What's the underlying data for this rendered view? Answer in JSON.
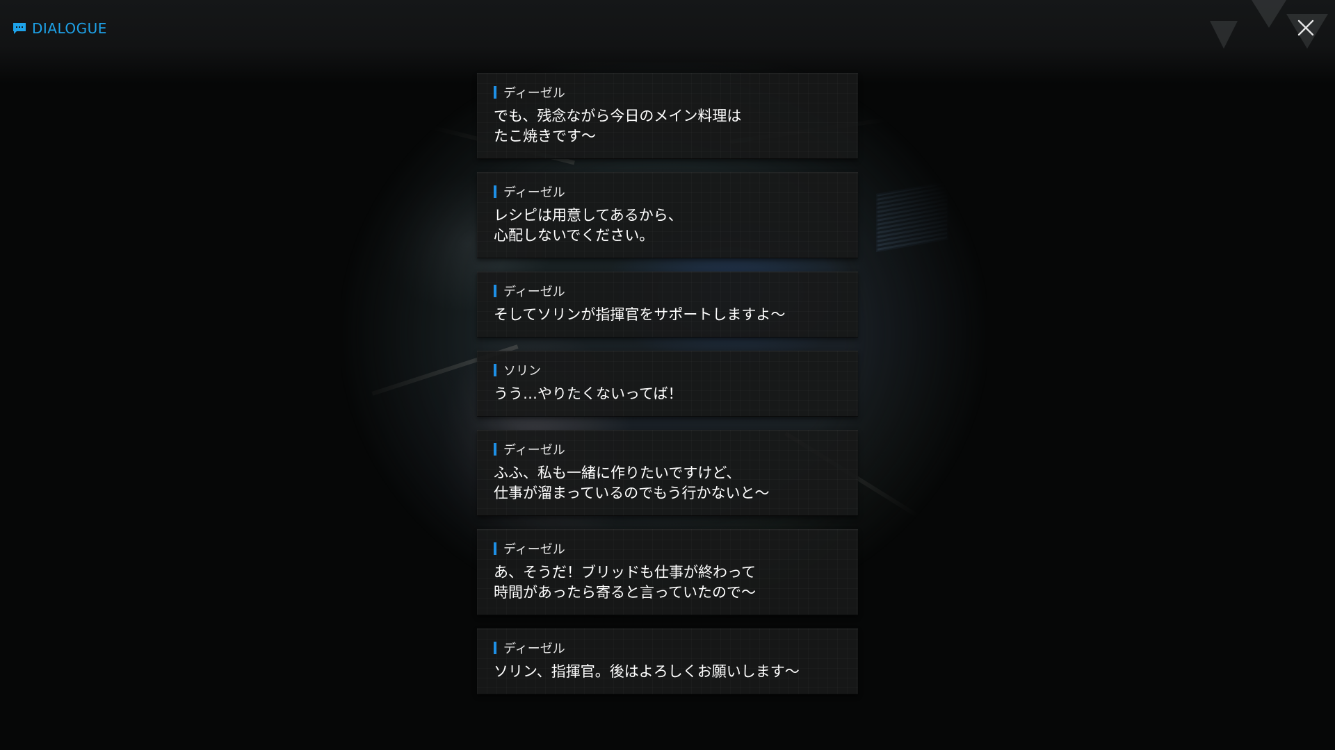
{
  "header": {
    "title": "DIALOGUE",
    "title_icon": "chat-bubble-icon",
    "close_icon": "close-icon",
    "accent_color": "#1ea3ea"
  },
  "dialogue": [
    {
      "speaker": "ディーゼル",
      "text": "でも、残念ながら今日のメイン料理は\nたこ焼きです～"
    },
    {
      "speaker": "ディーゼル",
      "text": "レシピは用意してあるから、\n心配しないでください。"
    },
    {
      "speaker": "ディーゼル",
      "text": "そしてソリンが指揮官をサポートしますよ～"
    },
    {
      "speaker": "ソリン",
      "text": "うう…やりたくないってば！"
    },
    {
      "speaker": "ディーゼル",
      "text": "ふふ、私も一緒に作りたいですけど、\n仕事が溜まっているのでもう行かないと～"
    },
    {
      "speaker": "ディーゼル",
      "text": "あ、そうだ！ブリッドも仕事が終わって\n時間があったら寄ると言っていたので～"
    },
    {
      "speaker": "ディーゼル",
      "text": "ソリン、指揮官。後はよろしくお願いします～"
    }
  ]
}
